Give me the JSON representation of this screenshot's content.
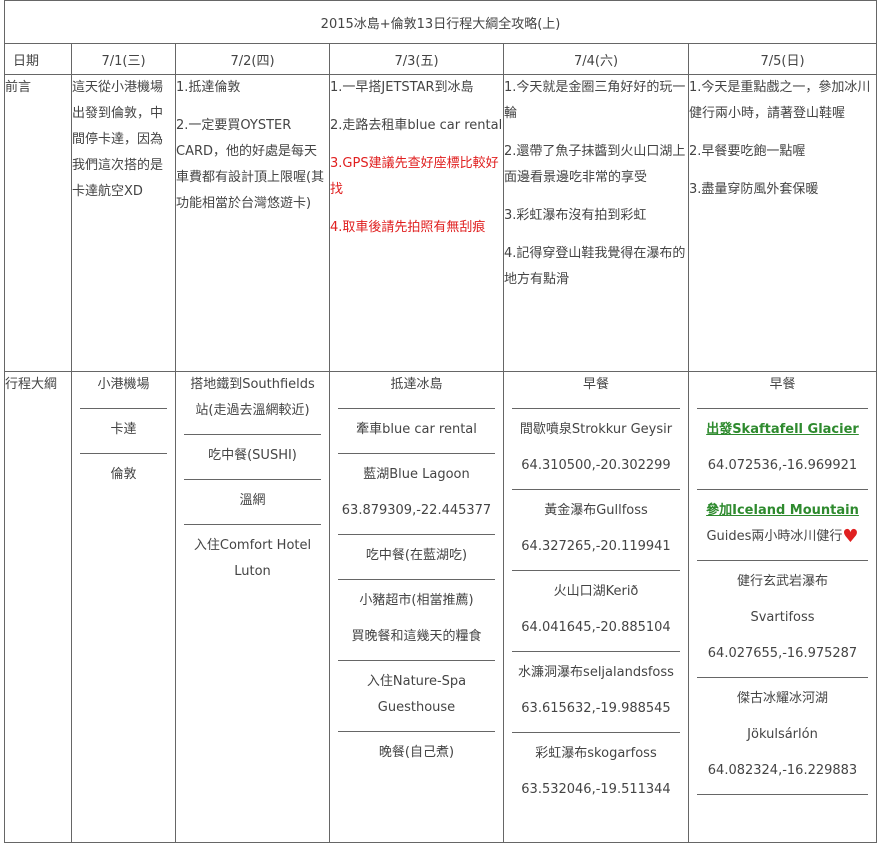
{
  "title": "2015冰島+倫敦13日行程大綱全攻略(上)",
  "header": {
    "date_label": "日期",
    "days": [
      "7/1(三)",
      "7/2(四)",
      "7/3(五)",
      "7/4(六)",
      "7/5(日)"
    ]
  },
  "intro": {
    "label": "前言",
    "cols": [
      [
        "這天從小港機場出發到倫敦，中間停卡達，因為我們這次搭的是卡達航空XD"
      ],
      [
        "1.抵達倫敦",
        "2.一定要買OYSTER CARD，他的好處是每天車費都有設計頂上限喔(其功能相當於台灣悠遊卡)"
      ],
      [
        "1.一早搭JETSTAR到冰島",
        "2.走路去租車blue car rental",
        "3.GPS建議先查好座標比較好找",
        "4.取車後請先拍照有無刮痕"
      ],
      [
        "1.今天就是金圈三角好好的玩一輪",
        "2.還帶了魚子抹醬到火山口湖上面邊看景邊吃非常的享受",
        "3.彩虹瀑布沒有拍到彩虹",
        "4.記得穿登山鞋我覺得在瀑布的地方有點滑"
      ],
      [
        "1.今天是重點戲之一，參加冰川健行兩小時，請著登山鞋喔",
        "2.早餐要吃飽一點喔",
        "3.盡量穿防風外套保暖"
      ]
    ]
  },
  "schedule": {
    "label": "行程大綱",
    "day1": [
      "小港機場",
      "卡達",
      "倫敦"
    ],
    "day2": [
      "搭地鐵到Southfields站(走過去溫網較近)",
      "吃中餐(SUSHI)",
      "溫網",
      "入住Comfort Hotel Luton"
    ],
    "day3": [
      "抵達冰島",
      "牽車blue car rental",
      "藍湖Blue Lagoon",
      "63.879309,-22.445377",
      "吃中餐(在藍湖吃)",
      "小豬超市(相當推薦)",
      "買晚餐和這幾天的糧食",
      "入住Nature-Spa Guesthouse",
      "晚餐(自己煮)"
    ],
    "day4": [
      "早餐",
      "間歇噴泉Strokkur Geysir",
      "64.310500,-20.302299",
      "黃金瀑布Gullfoss",
      "64.327265,-20.119941",
      "火山口湖Kerið",
      "64.041645,-20.885104",
      "水濂洞瀑布seljalandsfoss",
      "63.615632,-19.988545",
      "彩虹瀑布skogarfoss",
      "63.532046,-19.511344"
    ],
    "day5": [
      "早餐",
      "出發Skaftafell Glacier",
      "64.072536,-16.969921",
      "參加Iceland Mountain",
      "Guides兩小時冰川健行",
      "健行玄武岩瀑布",
      "Svartifoss",
      "64.027655,-16.975287",
      "傑古冰耀冰河湖",
      "Jökulsárlón",
      "64.082324,-16.229883"
    ]
  },
  "colors": {
    "border": "#666666",
    "text": "#444444",
    "highlight_red": "#e02020",
    "link_green": "#2e8a2e"
  },
  "icons": [
    "heart-icon"
  ]
}
